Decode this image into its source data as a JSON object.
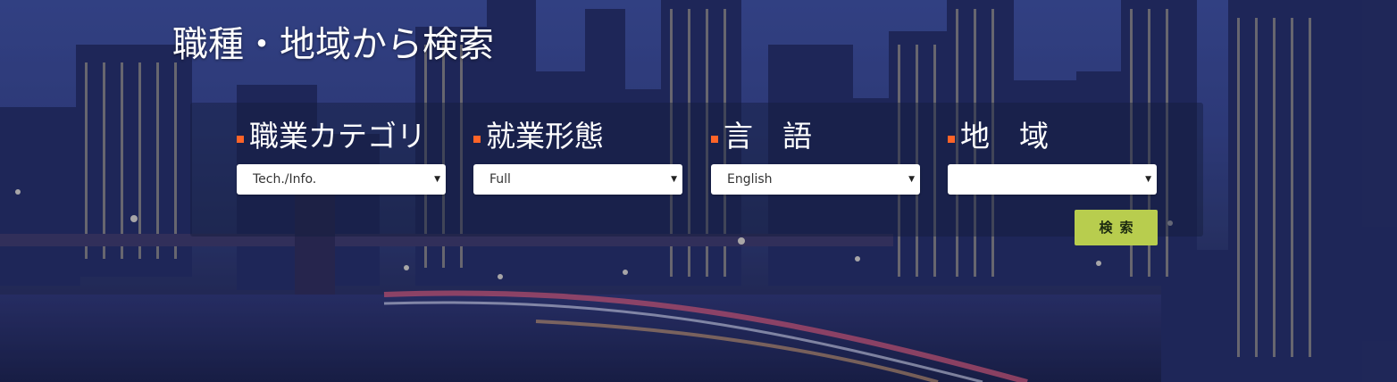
{
  "page": {
    "title": "職種・地域から検索"
  },
  "search": {
    "category": {
      "label": "職業カテゴリ",
      "value": "Tech./Info."
    },
    "employment": {
      "label": "就業形態",
      "value": "Full"
    },
    "language": {
      "label": "言　語",
      "value": "English"
    },
    "region": {
      "label": "地　域",
      "value": ""
    },
    "button_label": "検索"
  },
  "colors": {
    "accent_square": "#ff6428",
    "button_bg": "#b8cd4e",
    "panel_bg": "rgba(20,28,60,0.45)"
  },
  "icons": {
    "dropdown": "chevron-down-icon",
    "bullet": "square-bullet-icon"
  }
}
